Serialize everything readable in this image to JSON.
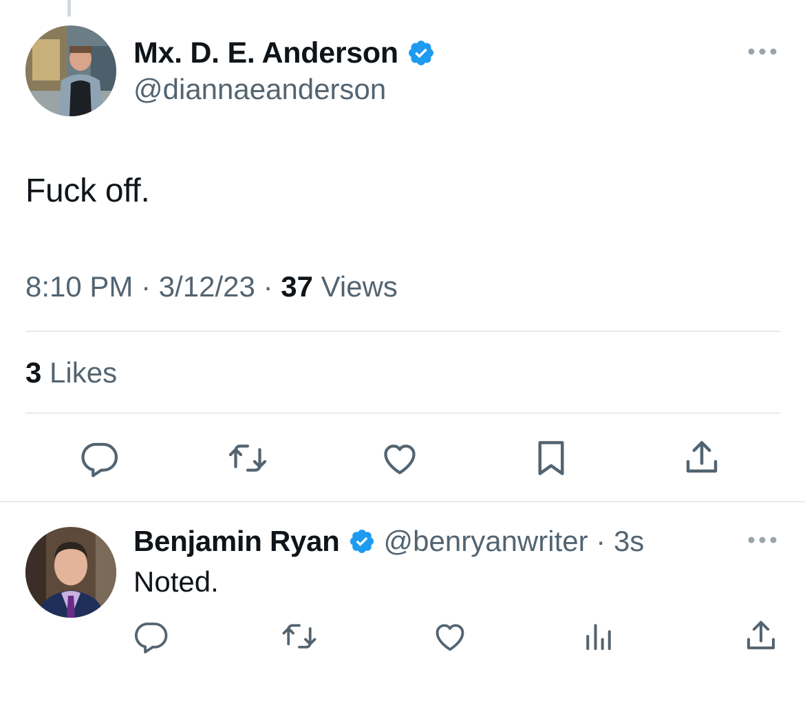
{
  "tweet": {
    "author": {
      "display_name": "Mx. D. E. Anderson",
      "handle": "@diannaeanderson",
      "verified": true
    },
    "text": "Fuck off.",
    "time": "8:10 PM",
    "separator": "·",
    "date": "3/12/23",
    "views_count": "37",
    "views_label": "Views",
    "likes_count": "3",
    "likes_label": "Likes",
    "actions": [
      "reply-icon",
      "retweet-icon",
      "like-icon",
      "bookmark-icon",
      "share-icon"
    ]
  },
  "reply": {
    "author": {
      "display_name": "Benjamin Ryan",
      "handle": "@benryanwriter",
      "verified": true
    },
    "separator": "·",
    "age": "3s",
    "text": "Noted.",
    "actions": [
      "reply-icon",
      "retweet-icon",
      "like-icon",
      "views-icon",
      "share-icon"
    ]
  },
  "colors": {
    "text_primary": "#0f1419",
    "text_secondary": "#536471",
    "verified_blue": "#1d9bf0",
    "divider": "#cfd9de"
  }
}
